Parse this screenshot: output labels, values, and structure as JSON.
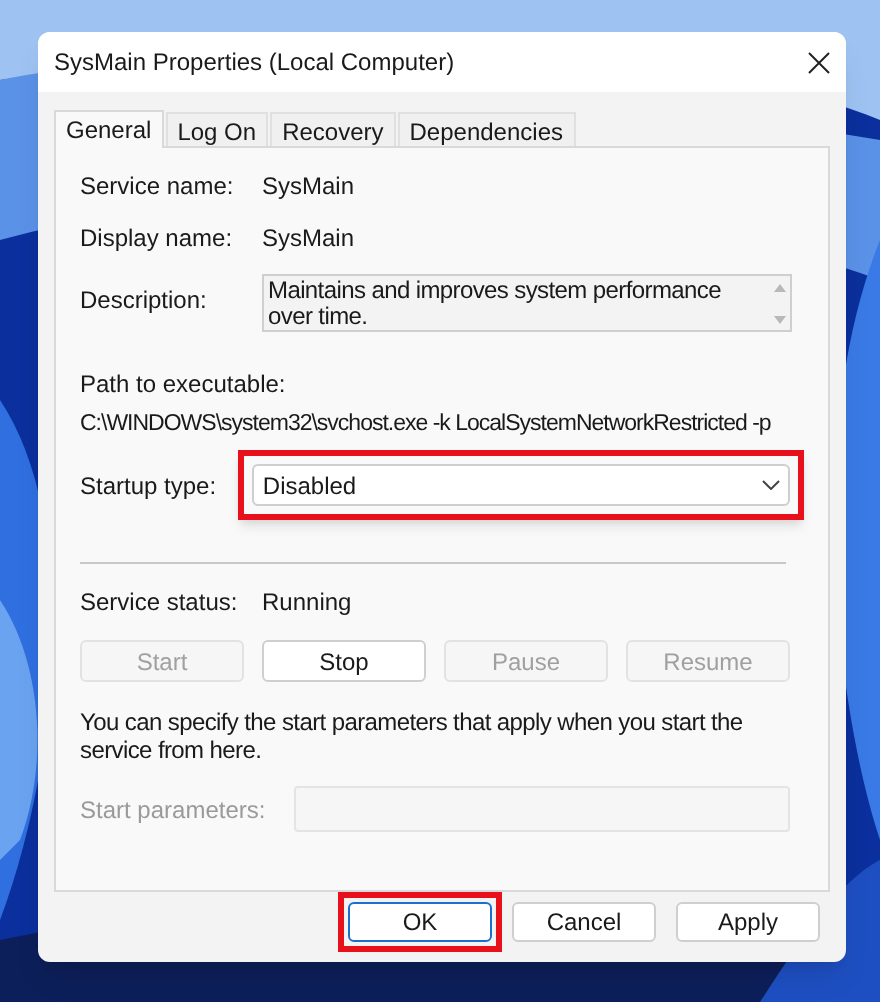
{
  "window": {
    "title": "SysMain Properties (Local Computer)"
  },
  "tabs": [
    {
      "label": "General",
      "selected": true
    },
    {
      "label": "Log On",
      "selected": false
    },
    {
      "label": "Recovery",
      "selected": false
    },
    {
      "label": "Dependencies",
      "selected": false
    }
  ],
  "fields": [
    {
      "label": "Service name:",
      "value": "SysMain"
    },
    {
      "label": "Display name:",
      "value": "SysMain"
    }
  ],
  "description": {
    "label": "Description:",
    "value": "Maintains and improves system performance over time."
  },
  "path": {
    "label": "Path to executable:",
    "value": "C:\\WINDOWS\\system32\\svchost.exe -k LocalSystemNetworkRestricted -p"
  },
  "startup_type": {
    "label": "Startup type:",
    "value": "Disabled",
    "highlighted": true
  },
  "service_status": {
    "label": "Service status:",
    "value": "Running"
  },
  "service_buttons": [
    {
      "label": "Start",
      "disabled": true
    },
    {
      "label": "Stop",
      "disabled": false
    },
    {
      "label": "Pause",
      "disabled": true
    },
    {
      "label": "Resume",
      "disabled": true
    }
  ],
  "hint": "You can specify the start parameters that apply when you start the service from here.",
  "start_parameters": {
    "label": "Start parameters:",
    "disabled": true
  },
  "dialog_buttons": [
    {
      "label": "OK",
      "default": true,
      "highlighted": true
    },
    {
      "label": "Cancel",
      "default": false,
      "highlighted": false
    },
    {
      "label": "Apply",
      "default": false,
      "highlighted": false
    }
  ]
}
